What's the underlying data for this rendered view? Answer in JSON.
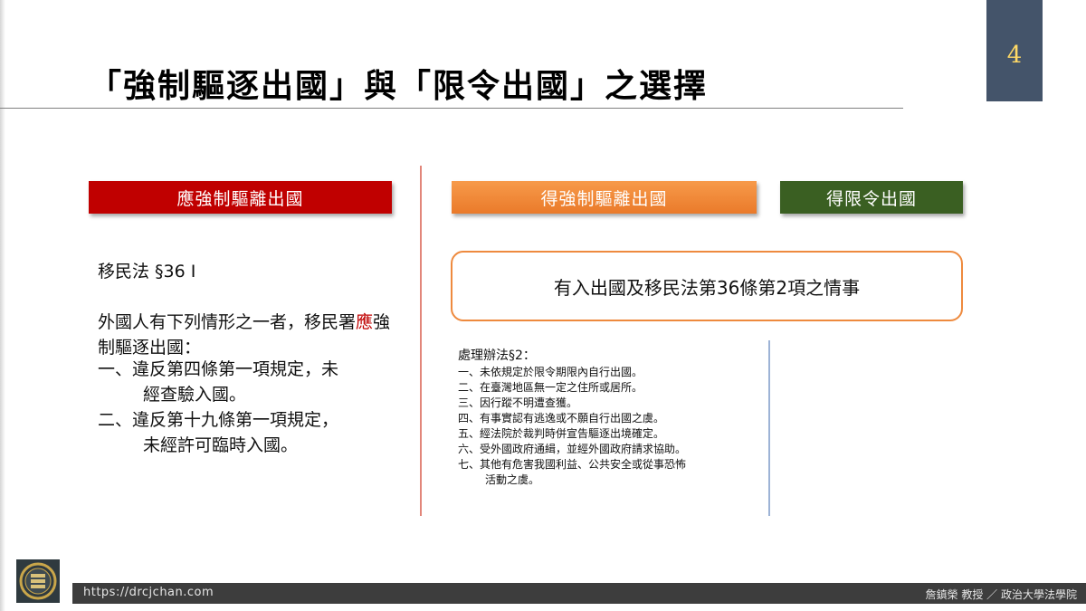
{
  "slide": {
    "title": "「強制驅逐出國」與「限令出國」之選擇",
    "page_number": "4"
  },
  "headers": {
    "must_deport": "應強制驅離出國",
    "may_deport": "得強制驅離出國",
    "order_leave": "得限令出國"
  },
  "left": {
    "law_ref": "移民法 §36 I",
    "intro_before": "外國人有下列情形之一者，移民署",
    "intro_highlight": "應",
    "intro_after": "強制驅逐出國：",
    "items": [
      {
        "line1": "一、違反第四條第一項規定，未",
        "line2": "經查驗入國。"
      },
      {
        "line1": "二、違反第十九條第一項規定，",
        "line2": "未經許可臨時入國。"
      }
    ]
  },
  "right": {
    "condition": "有入出國及移民法第36條第2項之情事",
    "rules_title": "處理辦法§2：",
    "rules": [
      {
        "text": "一、未依規定於限令期限內自行出國。"
      },
      {
        "text": "二、在臺灣地區無一定之住所或居所。"
      },
      {
        "text": "三、因行蹤不明遭查獲。"
      },
      {
        "text": "四、有事實認有逃逸或不願自行出國之虞。"
      },
      {
        "text": "五、經法院於裁判時併宣告驅逐出境確定。"
      },
      {
        "text": "六、受外國政府通緝，並經外國政府請求協助。"
      },
      {
        "text": "七、其他有危害我國利益、公共安全或從事恐怖",
        "cont": "活動之虞。"
      }
    ]
  },
  "footer": {
    "url": "https://drcjchan.com",
    "author": "詹鎮榮 教授 ／ 政治大學法學院"
  },
  "colors": {
    "must_header": "#c00000",
    "may_header": "#ea7a2a",
    "order_header": "#3a5f22",
    "page_badge": "#44546a",
    "page_number": "#ffd966",
    "condition_border": "#ee8a3e",
    "highlight": "#c00000"
  },
  "icons": {
    "logo": "book-seal-icon"
  }
}
